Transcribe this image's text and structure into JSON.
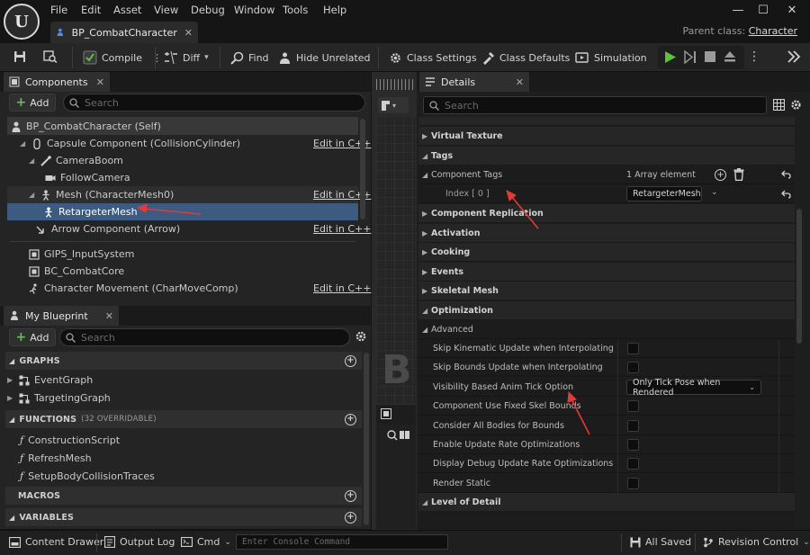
{
  "menu": [
    "File",
    "Edit",
    "Asset",
    "View",
    "Debug",
    "Window",
    "Tools",
    "Help"
  ],
  "window_controls": {
    "minimize": "—",
    "maximize": "☐",
    "close": "✕"
  },
  "document_tab": {
    "title": "BP_CombatCharacter",
    "close": "✕"
  },
  "parent_class": {
    "label": "Parent class:",
    "value": "Character"
  },
  "toolbar": {
    "compile": "Compile",
    "diff": "Diff",
    "find": "Find",
    "hide_unrelated": "Hide Unrelated",
    "class_settings": "Class Settings",
    "class_defaults": "Class Defaults",
    "simulation": "Simulation"
  },
  "components_panel": {
    "tab": "Components",
    "add_label": "Add",
    "search_placeholder": "Search",
    "items": [
      {
        "label": "BP_CombatCharacter (Self)",
        "icon": "person-icon"
      },
      {
        "label": "Capsule Component (CollisionCylinder)",
        "icon": "capsule-icon",
        "edit": "Edit in C++"
      },
      {
        "label": "CameraBoom",
        "icon": "spring-arm-icon"
      },
      {
        "label": "FollowCamera",
        "icon": "camera-icon"
      },
      {
        "label": "Mesh (CharacterMesh0)",
        "icon": "skeletal-mesh-icon",
        "edit": "Edit in C++"
      },
      {
        "label": "RetargeterMesh",
        "icon": "skeletal-mesh-icon"
      },
      {
        "label": "Arrow Component (Arrow)",
        "icon": "arrow-icon",
        "edit": "Edit in C++"
      },
      {
        "label": "GIPS_InputSystem",
        "icon": "component-icon"
      },
      {
        "label": "BC_CombatCore",
        "icon": "component-icon"
      },
      {
        "label": "Character Movement (CharMoveComp)",
        "icon": "movement-icon",
        "edit": "Edit in C++"
      }
    ]
  },
  "my_blueprint_panel": {
    "tab": "My Blueprint",
    "add_label": "Add",
    "search_placeholder": "Search",
    "graphs_header": "GRAPHS",
    "graphs": [
      "EventGraph",
      "TargetingGraph"
    ],
    "functions_header": "FUNCTIONS",
    "functions_overridable": "(32 OVERRIDABLE)",
    "functions": [
      "ConstructionScript",
      "RefreshMesh",
      "SetupBodyCollisionTraces"
    ],
    "macros_header": "MACROS",
    "variables_header": "VARIABLES"
  },
  "viewport": {
    "watermark": "B"
  },
  "details_panel": {
    "tab": "Details",
    "search_placeholder": "Search",
    "rows": {
      "virtual_texture": "Virtual Texture",
      "tags": "Tags",
      "component_tags": "Component Tags",
      "array_count": "1 Array element",
      "index_label": "Index [ 0 ]",
      "index_value": "RetargeterMesh",
      "component_replication": "Component Replication",
      "activation": "Activation",
      "cooking": "Cooking",
      "events": "Events",
      "skeletal_mesh": "Skeletal Mesh",
      "optimization": "Optimization",
      "advanced": "Advanced",
      "skip_kinematic": "Skip Kinematic Update when Interpolating",
      "skip_bounds": "Skip Bounds Update when Interpolating",
      "visibility_anim_tick": "Visibility Based Anim Tick Option",
      "visibility_anim_tick_value": "Only Tick Pose when Rendered",
      "fixed_skel_bounds": "Component Use Fixed Skel Bounds",
      "all_bodies_bounds": "Consider All Bodies for Bounds",
      "update_rate_opt": "Enable Update Rate Optimizations",
      "debug_update_rate_opt": "Display Debug Update Rate Optimizations",
      "render_static": "Render Static",
      "level_of_detail": "Level of Detail"
    }
  },
  "bottom_bar": {
    "content_drawer": "Content Drawer",
    "output_log": "Output Log",
    "cmd": "Cmd",
    "console_placeholder": "Enter Console Command",
    "all_saved": "All Saved",
    "revision_control": "Revision Control"
  },
  "colors": {
    "annotation_arrow": "#e03a3a",
    "selection": "#3d5a80",
    "play_green": "#5fbf3f",
    "add_plus": "#63c152"
  }
}
